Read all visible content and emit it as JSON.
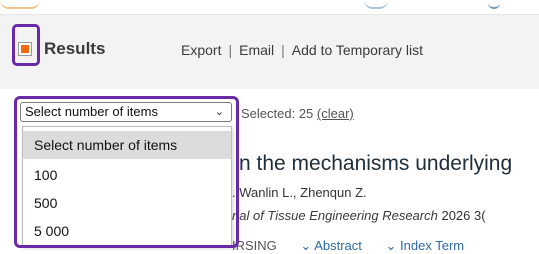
{
  "header": {
    "results_label": "Results",
    "actions": [
      "Export",
      "Email",
      "Add to Temporary list"
    ],
    "separator": "|"
  },
  "selection": {
    "select_value": "Select number of items",
    "caret_glyph": "⌄",
    "selected_label": "Selected:",
    "selected_count": "25",
    "clear_label": "(clear)"
  },
  "dropdown": {
    "options": [
      "Select number of items",
      "100",
      "500",
      "5 000"
    ],
    "highlighted_index": 0
  },
  "result": {
    "title_partial": "n the mechanisms underlying",
    "authors_partial": ". Wanlin L., Zhenqun Z.",
    "journal_partial": "nal of Tissue Engineering Research",
    "journal_tail": "2026 3(",
    "bottom_partial": "IRSING",
    "link_abstract": "Abstract",
    "link_index_terms": "Index Term"
  },
  "colors": {
    "highlight_border": "#6a2aa8",
    "checkbox_fill": "#ef6a10",
    "link_blue": "#2e6aa8"
  }
}
